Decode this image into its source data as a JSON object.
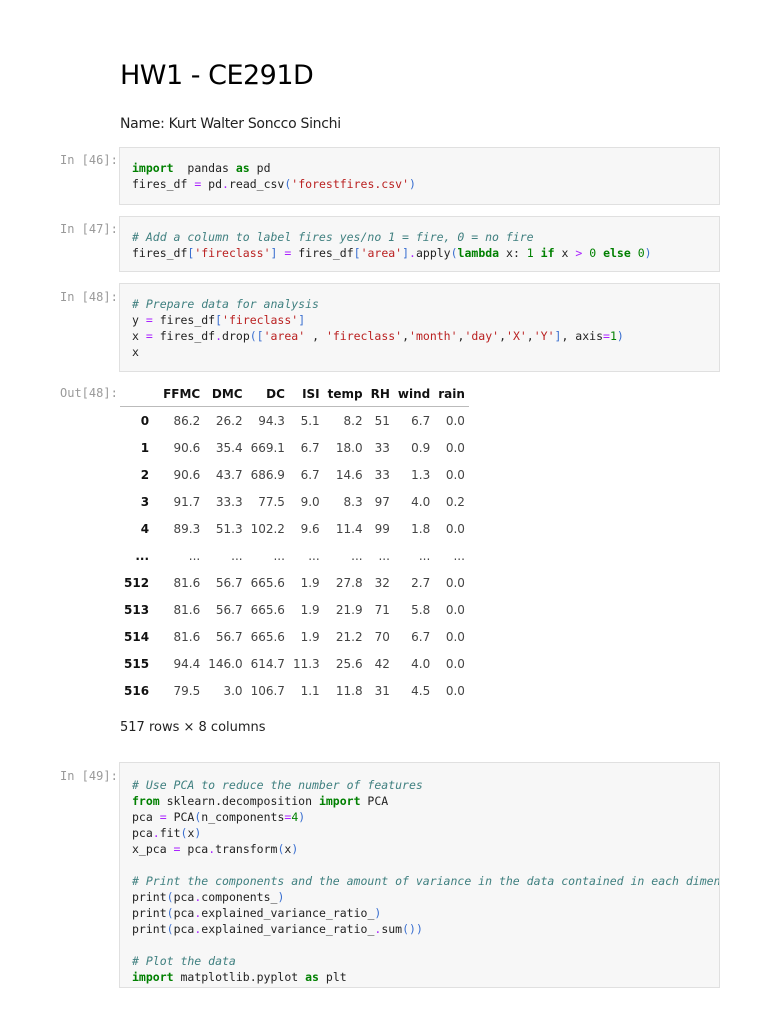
{
  "title": "HW1 - CE291D",
  "name_line": "Name: Kurt Walter Soncco Sinchi",
  "cells": [
    {
      "prompt": "In [46]:",
      "lines": [
        [
          [
            "k",
            "import"
          ],
          [
            "",
            "  pandas "
          ],
          [
            "k",
            "as"
          ],
          [
            "",
            " pd"
          ]
        ],
        [
          [
            "",
            "fires_df "
          ],
          [
            "o",
            "="
          ],
          [
            "",
            " pd"
          ],
          [
            "o",
            "."
          ],
          [
            "",
            "read_csv"
          ],
          [
            "p",
            "("
          ],
          [
            "s",
            "'forestfires.csv'"
          ],
          [
            "p",
            ")"
          ]
        ]
      ]
    },
    {
      "prompt": "In [47]:",
      "lines": [
        [
          [
            "c",
            "# Add a column to label fires yes/no 1 = fire, 0 = no fire"
          ]
        ],
        [
          [
            "",
            "fires_df"
          ],
          [
            "p",
            "["
          ],
          [
            "s",
            "'fireclass'"
          ],
          [
            "p",
            "]"
          ],
          [
            "",
            " "
          ],
          [
            "o",
            "="
          ],
          [
            "",
            " fires_df"
          ],
          [
            "p",
            "["
          ],
          [
            "s",
            "'area'"
          ],
          [
            "p",
            "]"
          ],
          [
            "o",
            "."
          ],
          [
            "",
            "apply"
          ],
          [
            "p",
            "("
          ],
          [
            "k",
            "lambda"
          ],
          [
            "",
            " x: "
          ],
          [
            "n",
            "1"
          ],
          [
            "",
            " "
          ],
          [
            "k",
            "if"
          ],
          [
            "",
            " x "
          ],
          [
            "o",
            ">"
          ],
          [
            "",
            " "
          ],
          [
            "n",
            "0"
          ],
          [
            "",
            " "
          ],
          [
            "k",
            "else"
          ],
          [
            "",
            " "
          ],
          [
            "n",
            "0"
          ],
          [
            "p",
            ")"
          ]
        ]
      ]
    },
    {
      "prompt": "In [48]:",
      "lines": [
        [
          [
            "c",
            "# Prepare data for analysis"
          ]
        ],
        [
          [
            "",
            "y "
          ],
          [
            "o",
            "="
          ],
          [
            "",
            " fires_df"
          ],
          [
            "p",
            "["
          ],
          [
            "s",
            "'fireclass'"
          ],
          [
            "p",
            "]"
          ]
        ],
        [
          [
            "",
            "x "
          ],
          [
            "o",
            "="
          ],
          [
            "",
            " fires_df"
          ],
          [
            "o",
            "."
          ],
          [
            "",
            "drop"
          ],
          [
            "p",
            "(["
          ],
          [
            "s",
            "'area'"
          ],
          [
            "",
            " , "
          ],
          [
            "s",
            "'fireclass'"
          ],
          [
            "",
            ","
          ],
          [
            "s",
            "'month'"
          ],
          [
            "",
            ","
          ],
          [
            "s",
            "'day'"
          ],
          [
            "",
            ","
          ],
          [
            "s",
            "'X'"
          ],
          [
            "",
            ","
          ],
          [
            "s",
            "'Y'"
          ],
          [
            "p",
            "]"
          ],
          [
            "",
            ", axis"
          ],
          [
            "o",
            "="
          ],
          [
            "n",
            "1"
          ],
          [
            "p",
            ")"
          ]
        ],
        [
          [
            "",
            "x"
          ]
        ]
      ]
    },
    {
      "prompt": "In [49]:",
      "lines": [
        [
          [
            "c",
            "# Use PCA to reduce the number of features"
          ]
        ],
        [
          [
            "k",
            "from"
          ],
          [
            "",
            " sklearn.decomposition "
          ],
          [
            "k",
            "import"
          ],
          [
            "",
            " PCA"
          ]
        ],
        [
          [
            "",
            "pca "
          ],
          [
            "o",
            "="
          ],
          [
            "",
            " PCA"
          ],
          [
            "p",
            "("
          ],
          [
            "",
            "n_components"
          ],
          [
            "o",
            "="
          ],
          [
            "n",
            "4"
          ],
          [
            "p",
            ")"
          ]
        ],
        [
          [
            "",
            "pca"
          ],
          [
            "o",
            "."
          ],
          [
            "",
            "fit"
          ],
          [
            "p",
            "("
          ],
          [
            "",
            "x"
          ],
          [
            "p",
            ")"
          ]
        ],
        [
          [
            "",
            "x_pca "
          ],
          [
            "o",
            "="
          ],
          [
            "",
            " pca"
          ],
          [
            "o",
            "."
          ],
          [
            "",
            "transform"
          ],
          [
            "p",
            "("
          ],
          [
            "",
            "x"
          ],
          [
            "p",
            ")"
          ]
        ],
        [],
        [
          [
            "c",
            "# Print the components and the amount of variance in the data contained in each dimension"
          ]
        ],
        [
          [
            "",
            "print"
          ],
          [
            "p",
            "("
          ],
          [
            "",
            "pca"
          ],
          [
            "o",
            "."
          ],
          [
            "",
            "components_"
          ],
          [
            "p",
            ")"
          ]
        ],
        [
          [
            "",
            "print"
          ],
          [
            "p",
            "("
          ],
          [
            "",
            "pca"
          ],
          [
            "o",
            "."
          ],
          [
            "",
            "explained_variance_ratio_"
          ],
          [
            "p",
            ")"
          ]
        ],
        [
          [
            "",
            "print"
          ],
          [
            "p",
            "("
          ],
          [
            "",
            "pca"
          ],
          [
            "o",
            "."
          ],
          [
            "",
            "explained_variance_ratio_"
          ],
          [
            "o",
            "."
          ],
          [
            "",
            "sum"
          ],
          [
            "p",
            "())"
          ]
        ],
        [],
        [
          [
            "c",
            "# Plot the data"
          ]
        ],
        [
          [
            "k",
            "import"
          ],
          [
            "",
            " matplotlib.pyplot "
          ],
          [
            "k",
            "as"
          ],
          [
            "",
            " plt"
          ]
        ]
      ]
    }
  ],
  "output": {
    "prompt": "Out[48]:",
    "columns": [
      "FFMC",
      "DMC",
      "DC",
      "ISI",
      "temp",
      "RH",
      "wind",
      "rain"
    ],
    "rows": [
      [
        "0",
        "86.2",
        "26.2",
        "94.3",
        "5.1",
        "8.2",
        "51",
        "6.7",
        "0.0"
      ],
      [
        "1",
        "90.6",
        "35.4",
        "669.1",
        "6.7",
        "18.0",
        "33",
        "0.9",
        "0.0"
      ],
      [
        "2",
        "90.6",
        "43.7",
        "686.9",
        "6.7",
        "14.6",
        "33",
        "1.3",
        "0.0"
      ],
      [
        "3",
        "91.7",
        "33.3",
        "77.5",
        "9.0",
        "8.3",
        "97",
        "4.0",
        "0.2"
      ],
      [
        "4",
        "89.3",
        "51.3",
        "102.2",
        "9.6",
        "11.4",
        "99",
        "1.8",
        "0.0"
      ],
      [
        "...",
        "...",
        "...",
        "...",
        "...",
        "...",
        "...",
        "...",
        "..."
      ],
      [
        "512",
        "81.6",
        "56.7",
        "665.6",
        "1.9",
        "27.8",
        "32",
        "2.7",
        "0.0"
      ],
      [
        "513",
        "81.6",
        "56.7",
        "665.6",
        "1.9",
        "21.9",
        "71",
        "5.8",
        "0.0"
      ],
      [
        "514",
        "81.6",
        "56.7",
        "665.6",
        "1.9",
        "21.2",
        "70",
        "6.7",
        "0.0"
      ],
      [
        "515",
        "94.4",
        "146.0",
        "614.7",
        "11.3",
        "25.6",
        "42",
        "4.0",
        "0.0"
      ],
      [
        "516",
        "79.5",
        "3.0",
        "106.7",
        "1.1",
        "11.8",
        "31",
        "4.5",
        "0.0"
      ]
    ],
    "shape": "517 rows × 8 columns"
  }
}
